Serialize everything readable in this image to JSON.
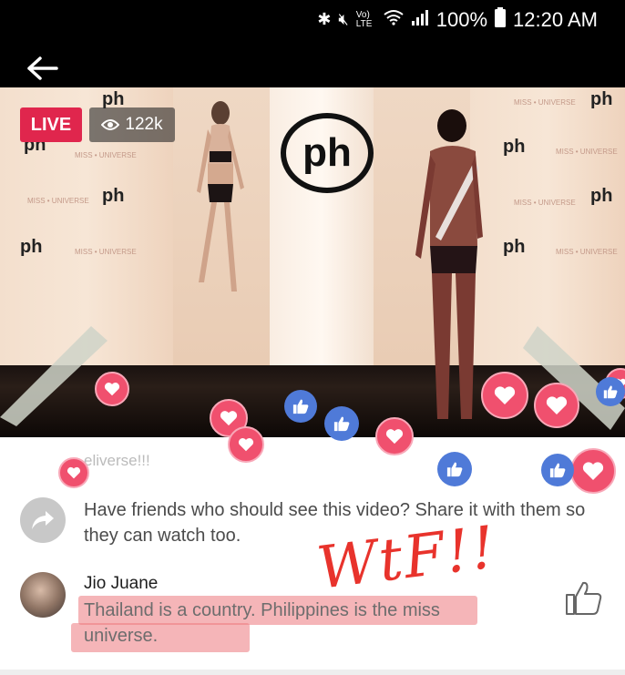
{
  "status_bar": {
    "icons": [
      "bluetooth-icon",
      "mute-icon",
      "volte-icon",
      "wifi-icon",
      "signal-icon",
      "battery-icon"
    ],
    "volte_label": "Vo) LTE",
    "battery": "100%",
    "time": "12:20 AM"
  },
  "video": {
    "live_label": "LIVE",
    "viewer_count": "122k",
    "brand_logo": "ph",
    "banner_text": "MISS • UNIVERSE"
  },
  "reactions": {
    "heart_color": "#f0506e",
    "like_color": "#4f7ad8"
  },
  "comments": {
    "faded_comment": "eliverse!!!",
    "share_prompt": "Have friends who should see this video? Share it with them so they can watch too.",
    "comment": {
      "author": "Jio Juane",
      "text": "Thailand is a country. Philippines is the miss universe."
    }
  },
  "annotation": {
    "text": "WtF!!",
    "color": "#e8332c"
  }
}
